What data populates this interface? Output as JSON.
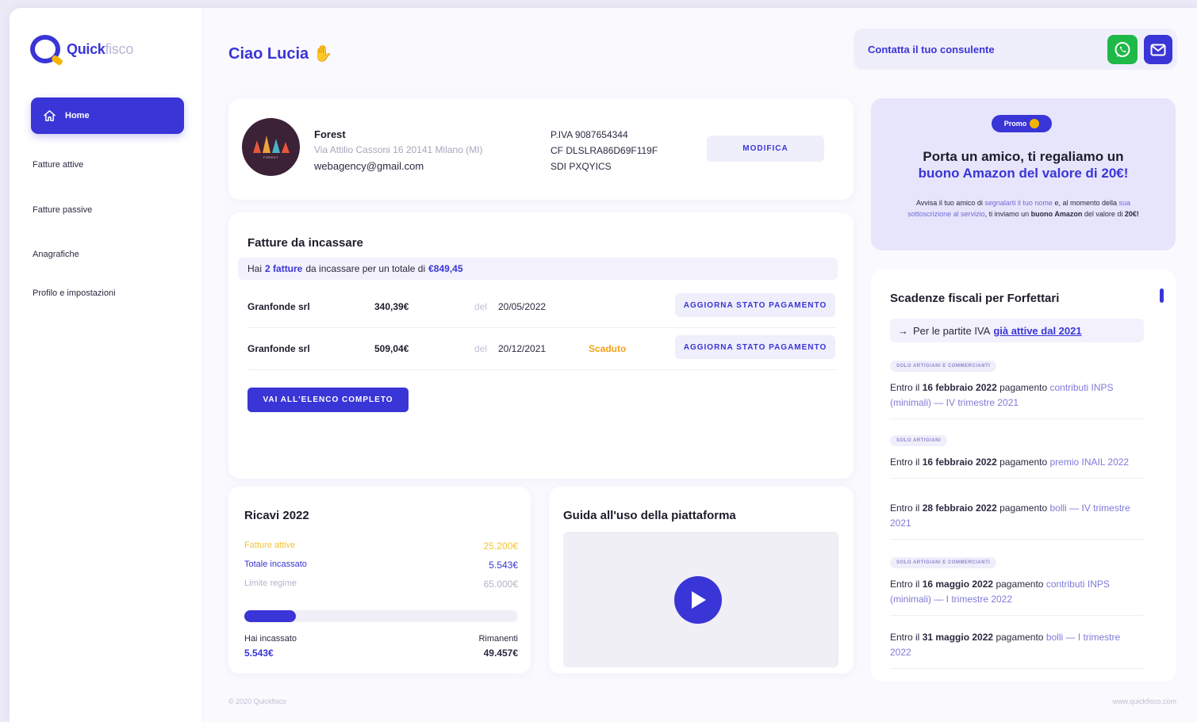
{
  "brand": {
    "name_bold": "Quick",
    "name_light": "fisco"
  },
  "sidebar": {
    "items": [
      {
        "label": "Home"
      },
      {
        "label": "Fatture attive"
      },
      {
        "label": "Fatture passive"
      },
      {
        "label": "Anagrafiche"
      },
      {
        "label": "Profilo e impostazioni"
      }
    ]
  },
  "header": {
    "greeting": "Ciao Lucia",
    "contact_label": "Contatta il tuo consulente"
  },
  "profile": {
    "name": "Forest",
    "address": "Via Attilio Cassoni 16 20141 Milano (MI)",
    "email": "webagency@gmail.com",
    "piva": "P.IVA 9087654344",
    "cf": "CF DLSLRA86D69F119F",
    "sdi": "SDI PXQYICS",
    "edit_label": "MODIFICA",
    "avatar_caption": "FOREST"
  },
  "invoices": {
    "title": "Fatture da incassare",
    "summary_prefix": "Hai",
    "summary_count": "2 fatture",
    "summary_middle": "da incassare per un totale di",
    "summary_total": "€849,45",
    "rows": [
      {
        "client": "Granfonde srl",
        "amount": "340,39€",
        "del": "del",
        "date": "20/05/2022",
        "status": "",
        "action": "AGGIORNA STATO PAGAMENTO"
      },
      {
        "client": "Granfonde srl",
        "amount": "509,04€",
        "del": "del",
        "date": "20/12/2021",
        "status": "Scaduto",
        "action": "AGGIORNA STATO PAGAMENTO"
      }
    ],
    "full_list_label": "VAI ALL'ELENCO COMPLETO"
  },
  "revenue": {
    "title": "Ricavi 2022",
    "lines": [
      {
        "label": "Fatture attive",
        "value": "25.200€",
        "color": "#f4c430"
      },
      {
        "label": "Totale incassato",
        "value": "5.543€",
        "color": "#3a35d6"
      },
      {
        "label": "Limite regime",
        "value": "65.000€",
        "color": "#b5b3c8"
      }
    ],
    "progress_fraction": 0.085,
    "collected_label": "Hai incassato",
    "collected_value": "5.543€",
    "remaining_label": "Rimanenti",
    "remaining_value": "49.457€"
  },
  "guide": {
    "title": "Guida all'uso della piattaforma"
  },
  "promo": {
    "badge": "Promo",
    "headline": "Porta un amico, ti regaliamo un",
    "headline_accent": "buono Amazon del valore di 20€!",
    "body_1": "Avvisa il tuo amico di",
    "body_1_hl": "segnalarti il tuo nome",
    "body_2": "e, al momento della",
    "body_2_hl": "sua sottoscrizione al servizio",
    "body_3": ", ti inviamo un",
    "body_3_b": "buono Amazon",
    "body_4": "del valore di",
    "body_4_b": "20€!"
  },
  "deadlines": {
    "title": "Scadenze fiscali per Forfettari",
    "filter_prefix": "Per le partite IVA",
    "filter_link": "già attive dal 2021",
    "items": [
      {
        "tag": "SOLO ARTIGIANI E COMMERCIANTI",
        "pre": "Entro il",
        "date": "16 febbraio 2022",
        "mid": "pagamento",
        "what": "contributi INPS (minimali)",
        "post": "— IV trimestre 2021"
      },
      {
        "tag": "SOLO ARTIGIANI",
        "pre": "Entro il",
        "date": "16 febbraio 2022",
        "mid": "pagamento",
        "what": "premio INAIL 2022",
        "post": ""
      },
      {
        "tag": "",
        "pre": "Entro il",
        "date": "28 febbraio 2022",
        "mid": "pagamento",
        "what": "bolli — IV trimestre 2021",
        "post": ""
      },
      {
        "tag": "SOLO ARTIGIANI E COMMERCIANTI",
        "pre": "Entro il",
        "date": "16 maggio 2022",
        "mid": "pagamento",
        "what": "contributi INPS (minimali) — I trimestre 2022",
        "post": ""
      },
      {
        "tag": "",
        "pre": "Entro il",
        "date": "31 maggio 2022",
        "mid": "pagamento",
        "what": "bolli — I trimestre 2022",
        "post": ""
      }
    ]
  },
  "footer": {
    "copyright": "© 2020 Quickfisco",
    "site": "www.quickfisco.com"
  },
  "colors": {
    "accent": "#3a35d6",
    "whatsapp": "#1fb94a",
    "warning": "#f4a11a"
  }
}
